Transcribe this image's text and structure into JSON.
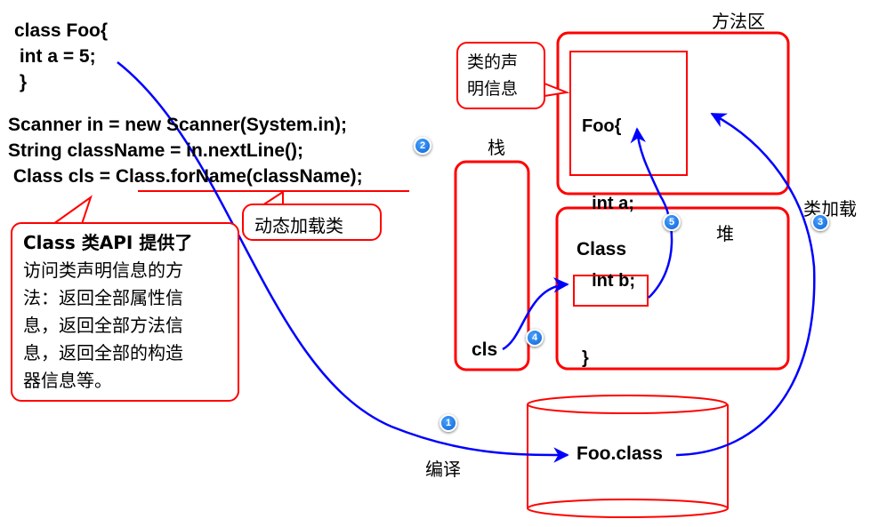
{
  "code": {
    "class_def": [
      "class Foo{",
      " int a = 5;",
      " }"
    ],
    "statements": [
      "Scanner in = new Scanner(System.in);",
      "String className = in.nextLine();",
      " Class cls = Class.forName(className);"
    ]
  },
  "callouts": {
    "dynamic_load": "动态加载类",
    "class_api": [
      "Class 类API 提供了",
      "访问类声明信息的方",
      "法：返回全部属性信",
      "息，返回全部方法信",
      "息，返回全部的构造",
      "器信息等。"
    ],
    "decl_info": [
      "类的声",
      "明信息"
    ]
  },
  "regions": {
    "method_area": "方法区",
    "stack": "栈",
    "heap": "堆"
  },
  "method_area_content": [
    "Foo{",
    "  int a;",
    "  int b;",
    "}"
  ],
  "heap_content": {
    "label": "Class"
  },
  "stack_content": {
    "var": "cls"
  },
  "file": {
    "label": "Foo.class"
  },
  "arrows": {
    "compile_label": "编译",
    "class_load_label": "类加载"
  },
  "badges": [
    "1",
    "2",
    "3",
    "4",
    "5"
  ],
  "colors": {
    "box": "#ff0000",
    "arrow": "#0000ff",
    "badge": "#1a7be8"
  }
}
